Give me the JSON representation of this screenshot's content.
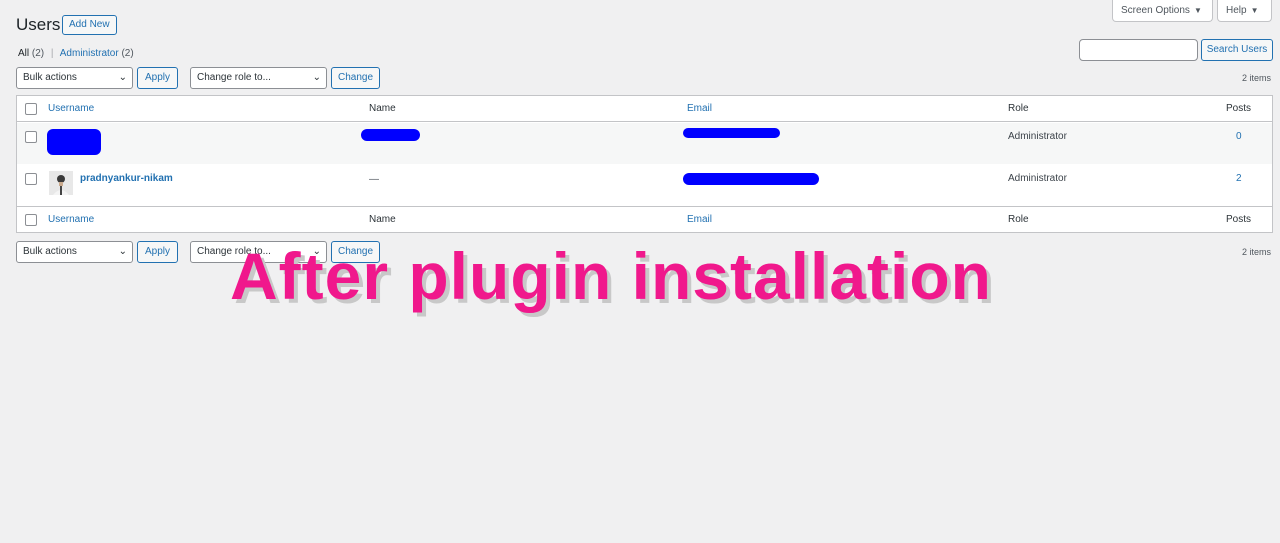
{
  "header": {
    "title": "Users",
    "add_new_label": "Add New",
    "screen_options_label": "Screen Options",
    "help_label": "Help"
  },
  "views": {
    "all_label": "All",
    "all_count": "(2)",
    "separator": "|",
    "admin_label": "Administrator",
    "admin_count": "(2)"
  },
  "search": {
    "value": "",
    "button_label": "Search Users"
  },
  "tablenav_top": {
    "bulk_actions": "Bulk actions",
    "apply_label": "Apply",
    "change_role": "Change role to...",
    "change_label": "Change",
    "items": "2 items"
  },
  "tablenav_bottom": {
    "bulk_actions": "Bulk actions",
    "apply_label": "Apply",
    "change_role": "Change role to...",
    "change_label": "Change",
    "items": "2 items"
  },
  "table": {
    "columns": [
      "Username",
      "Name",
      "Email",
      "Role",
      "Posts"
    ],
    "rows": [
      {
        "username": "",
        "name": "",
        "email": "",
        "role": "Administrator",
        "posts": "0"
      },
      {
        "username": "pradnyankur-nikam",
        "name": "—",
        "email": "",
        "role": "Administrator",
        "posts": "2"
      }
    ]
  },
  "overlay": {
    "text": "After plugin installation",
    "color": "#f0188c"
  },
  "colors": {
    "accent": "#2271b1",
    "redaction": "#0000ff",
    "background": "#f0f0f1"
  },
  "icons": {
    "dropdown": "caret-down-icon",
    "select": "chevron-down-icon"
  }
}
